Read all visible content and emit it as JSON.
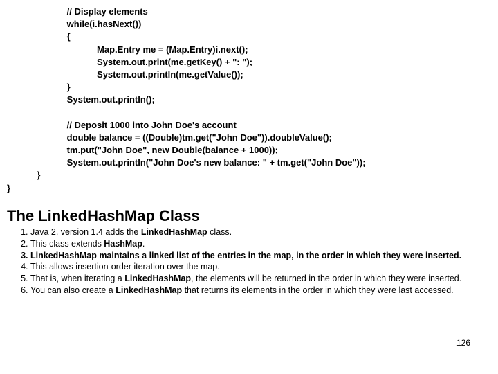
{
  "code": {
    "l1": "                        // Display elements",
    "l2": "                        while(i.hasNext())",
    "l3": "                        {",
    "l4": "                                    Map.Entry me = (Map.Entry)i.next();",
    "l5": "                                    System.out.print(me.getKey() + \": \");",
    "l6": "                                    System.out.println(me.getValue());",
    "l7": "                        }",
    "l8": "                        System.out.println();",
    "l9": "",
    "l10": "                        // Deposit 1000 into John Doe's account",
    "l11": "                        double balance = ((Double)tm.get(\"John Doe\")).doubleValue();",
    "l12": "                        tm.put(\"John Doe\", new Double(balance + 1000));",
    "l13": "                        System.out.println(\"John Doe's new balance: \" + tm.get(\"John Doe\"));",
    "l14": "            }",
    "l15": "}"
  },
  "heading": "The LinkedHashMap Class",
  "list": {
    "i1a": "Java 2, version 1.4 adds the ",
    "i1b": "LinkedHashMap",
    "i1c": " class.",
    "i2a": "This class extends ",
    "i2b": "HashMap",
    "i2c": ".",
    "i3a": "LinkedHashMap",
    "i3b": " maintains a linked list of the entries in the map, in the order in which they were inserted.",
    "i4": "This allows insertion-order iteration over the map.",
    "i5a": "That is, when iterating a ",
    "i5b": "LinkedHashMap",
    "i5c": ", the elements will be returned in the order in which they were inserted.",
    "i6a": "You can also create a ",
    "i6b": "LinkedHashMap",
    "i6c": " that returns its elements in the order in which they were last accessed."
  },
  "pageNumber": "126"
}
